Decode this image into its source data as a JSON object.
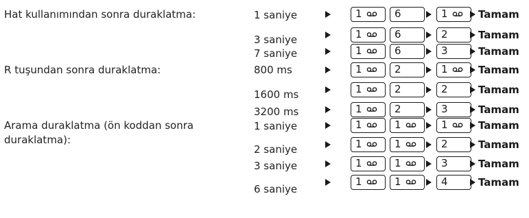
{
  "groups": [
    {
      "label": "Hat kullanımından sonra duraklatma:",
      "rows": [
        {
          "value": "1 saniye",
          "keys": [
            "1",
            "6",
            "1"
          ]
        },
        {
          "value": "3 saniye",
          "keys": [
            "1",
            "6",
            "2"
          ]
        },
        {
          "value": "7 saniye",
          "keys": [
            "1",
            "6",
            "3"
          ]
        }
      ]
    },
    {
      "label": "R tuşundan sonra duraklatma:",
      "rows": [
        {
          "value": "800 ms",
          "keys": [
            "1",
            "2",
            "1"
          ]
        },
        {
          "value": "1600 ms",
          "keys": [
            "1",
            "2",
            "2"
          ]
        },
        {
          "value": "3200 ms",
          "keys": [
            "1",
            "2",
            "3"
          ]
        }
      ]
    },
    {
      "label_lines": [
        "Arama duraklatma (ön koddan sonra",
        "duraklatma):"
      ],
      "rows": [
        {
          "value": "1 saniye",
          "keys": [
            "1",
            "1",
            "1"
          ]
        },
        {
          "value": "2 saniye",
          "keys": [
            "1",
            "1",
            "2"
          ]
        },
        {
          "value": "3 saniye",
          "keys": [
            "1",
            "1",
            "3"
          ]
        },
        {
          "value": "6 saniye",
          "keys": [
            "1",
            "1",
            "4"
          ]
        }
      ]
    }
  ],
  "confirm_label": "Tamam",
  "voicemail_key_icon": "voicemail-icon"
}
